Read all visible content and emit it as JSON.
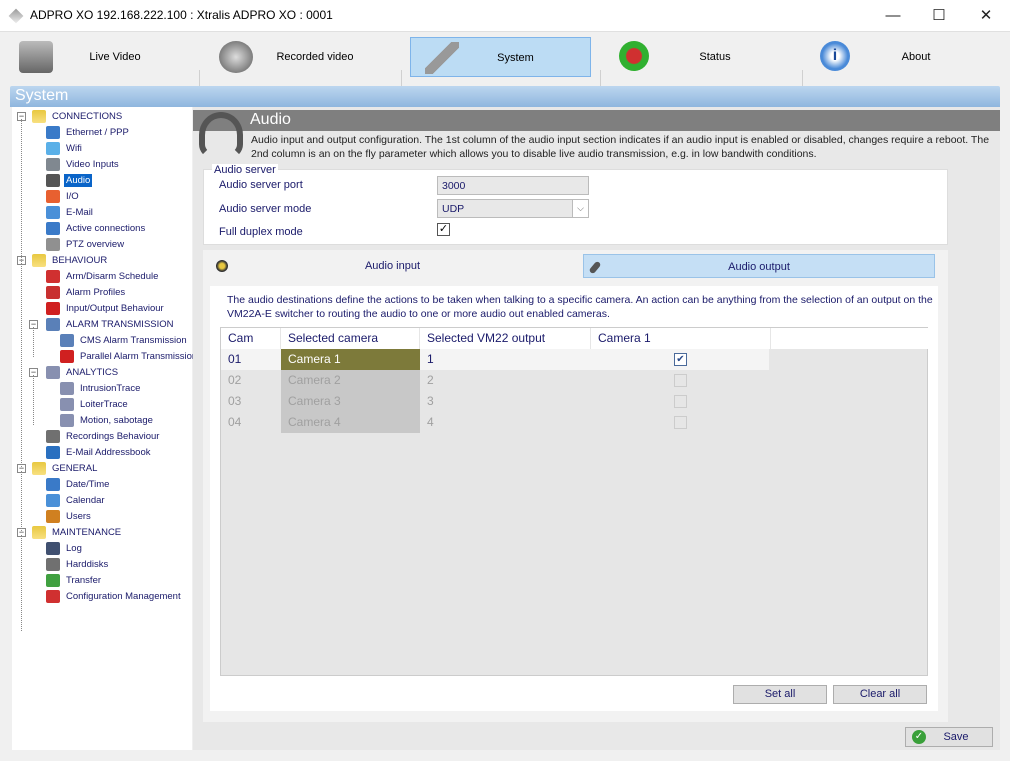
{
  "window": {
    "title": "ADPRO XO   192.168.222.100  :  Xtralis ADPRO XO  :  0001",
    "minimize": "—",
    "maximize": "☐",
    "close": "✕"
  },
  "toolbar": [
    {
      "label": "Live Video",
      "icon": "camera-icon"
    },
    {
      "label": "Recorded video",
      "icon": "film-reel-icon"
    },
    {
      "label": "System",
      "icon": "wrench-icon",
      "active": true
    },
    {
      "label": "Status",
      "icon": "lock-icon"
    },
    {
      "label": "About",
      "icon": "info-icon"
    }
  ],
  "section_title": "System",
  "tree": [
    {
      "label": "CONNECTIONS",
      "level": 0,
      "icon": "folder-icon",
      "color": "#e8c840"
    },
    {
      "label": "Ethernet / PPP",
      "level": 1,
      "icon": "network-icon",
      "color": "#3a7ac8"
    },
    {
      "label": "Wifi",
      "level": 1,
      "icon": "wifi-icon",
      "color": "#5ab0e8"
    },
    {
      "label": "Video Inputs",
      "level": 1,
      "icon": "camera-icon",
      "color": "#808890"
    },
    {
      "label": "Audio",
      "level": 1,
      "icon": "headset-icon",
      "color": "#555",
      "selected": true
    },
    {
      "label": "I/O",
      "level": 1,
      "icon": "io-arrows-icon",
      "color": "#e86030"
    },
    {
      "label": "E-Mail",
      "level": 1,
      "icon": "email-icon",
      "color": "#4a90d8"
    },
    {
      "label": "Active connections",
      "level": 1,
      "icon": "network-icon",
      "color": "#3a7ac8"
    },
    {
      "label": "PTZ overview",
      "level": 1,
      "icon": "joystick-icon",
      "color": "#909090"
    },
    {
      "label": "BEHAVIOUR",
      "level": 0,
      "icon": "folder-icon",
      "color": "#e8c840"
    },
    {
      "label": "Arm/Disarm Schedule",
      "level": 1,
      "icon": "schedule-icon",
      "color": "#d03030"
    },
    {
      "label": "Alarm Profiles",
      "level": 1,
      "icon": "alarm-profile-icon",
      "color": "#c83030"
    },
    {
      "label": "Input/Output Behaviour",
      "level": 1,
      "icon": "warning-icon",
      "color": "#d02020"
    },
    {
      "label": "ALARM TRANSMISSION",
      "level": 1,
      "icon": "alarm-transmission-icon",
      "color": "#5a80b8",
      "expander": true
    },
    {
      "label": "CMS Alarm Transmission",
      "level": 2,
      "icon": "alarm-transmission-icon",
      "color": "#5a80b8"
    },
    {
      "label": "Parallel Alarm Transmission",
      "level": 2,
      "icon": "warning-icon",
      "color": "#d02020"
    },
    {
      "label": "ANALYTICS",
      "level": 1,
      "icon": "gears-icon",
      "color": "#8890b0",
      "expander": true
    },
    {
      "label": "IntrusionTrace",
      "level": 2,
      "icon": "gears-icon",
      "color": "#8890b0"
    },
    {
      "label": "LoiterTrace",
      "level": 2,
      "icon": "gears-icon",
      "color": "#8890b0"
    },
    {
      "label": "Motion, sabotage",
      "level": 2,
      "icon": "gears-icon",
      "color": "#8890b0"
    },
    {
      "label": "Recordings Behaviour",
      "level": 1,
      "icon": "film-reel-icon",
      "color": "#707070"
    },
    {
      "label": "E-Mail Addressbook",
      "level": 1,
      "icon": "addressbook-icon",
      "color": "#2a70c0"
    },
    {
      "label": "GENERAL",
      "level": 0,
      "icon": "folder-icon",
      "color": "#e8c840"
    },
    {
      "label": "Date/Time",
      "level": 1,
      "icon": "clock-icon",
      "color": "#3a7ac8"
    },
    {
      "label": "Calendar",
      "level": 1,
      "icon": "calendar-icon",
      "color": "#4a90d8"
    },
    {
      "label": "Users",
      "level": 1,
      "icon": "users-icon",
      "color": "#d08020"
    },
    {
      "label": "MAINTENANCE",
      "level": 0,
      "icon": "folder-icon",
      "color": "#e8c840"
    },
    {
      "label": "Log",
      "level": 1,
      "icon": "log-icon",
      "color": "#405070"
    },
    {
      "label": "Harddisks",
      "level": 1,
      "icon": "harddisk-icon",
      "color": "#707070"
    },
    {
      "label": "Transfer",
      "level": 1,
      "icon": "transfer-icon",
      "color": "#40a040"
    },
    {
      "label": "Configuration Management",
      "level": 1,
      "icon": "checklist-icon",
      "color": "#d03030"
    }
  ],
  "page": {
    "title": "Audio",
    "description": "Audio input and output configuration. The 1st column of the audio input section indicates if an audio input is enabled or disabled, changes require a reboot. The 2nd column is an on the fly parameter which allows you to disable live audio transmission, e.g. in low bandwith conditions."
  },
  "audio_server": {
    "legend": "Audio server",
    "port_label": "Audio server port",
    "port_value": "3000",
    "mode_label": "Audio server mode",
    "mode_value": "UDP",
    "duplex_label": "Full duplex mode",
    "duplex_checked": true
  },
  "tabs": [
    {
      "label": "Audio input",
      "icon": "speaker-icon"
    },
    {
      "label": "Audio output",
      "icon": "microphone-icon",
      "active": true
    }
  ],
  "output": {
    "description": "The audio destinations define the actions to be taken when talking to a specific camera. An action can be anything from the selection of an output on the VM22A-E switcher to routing the audio to one or more audio out enabled cameras.",
    "columns": [
      "Cam",
      "Selected camera",
      "Selected VM22 output",
      "Camera 1"
    ],
    "rows": [
      {
        "cam": "01",
        "camera": "Camera 1",
        "output": "1",
        "checked": true,
        "enabled": true
      },
      {
        "cam": "02",
        "camera": "Camera 2",
        "output": "2",
        "checked": false,
        "enabled": false
      },
      {
        "cam": "03",
        "camera": "Camera 3",
        "output": "3",
        "checked": false,
        "enabled": false
      },
      {
        "cam": "04",
        "camera": "Camera 4",
        "output": "4",
        "checked": false,
        "enabled": false
      }
    ],
    "set_all": "Set all",
    "clear_all": "Clear all"
  },
  "save": "Save",
  "colors": {
    "selected_camera": "#7d7a3a",
    "tab_active": "#c5dff5",
    "tree_selected": "#0a64c8"
  }
}
